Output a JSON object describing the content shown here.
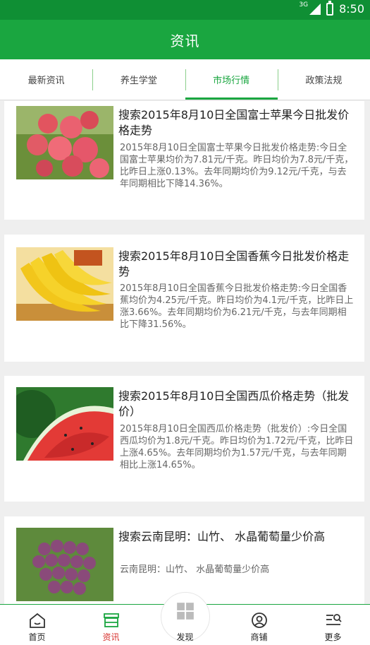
{
  "status_bar": {
    "network": "3G",
    "time": "8:50"
  },
  "header": {
    "title": "资讯"
  },
  "tabs": [
    {
      "label": "最新资讯",
      "active": false
    },
    {
      "label": "养生学堂",
      "active": false
    },
    {
      "label": "市场行情",
      "active": true
    },
    {
      "label": "政策法规",
      "active": false
    }
  ],
  "articles": [
    {
      "title": "搜索2015年8月10日全国富士苹果今日批发价格走势",
      "summary": "2015年8月10日全国富士苹果今日批发价格走势:今日全国富士苹果均价为7.81元/千克。昨日均价为7.8元/千克，比昨日上涨0.13%。去年同期均价为9.12元/千克，与去年同期相比下降14.36%。",
      "image": "apples"
    },
    {
      "title": "搜索2015年8月10日全国香蕉今日批发价格走势",
      "summary": " 2015年8月10日全国香蕉今日批发价格走势:今日全国香蕉均价为4.25元/千克。昨日均价为4.1元/千克，比昨日上涨3.66%。去年同期均价为6.21元/千克，与去年同期相比下降31.56%。",
      "image": "bananas"
    },
    {
      "title": "搜索2015年8月10日全国西瓜价格走势（批发价）",
      "summary": "2015年8月10日全国西瓜价格走势（批发价）:今日全国西瓜均价为1.8元/千克。昨日均价为1.72元/千克，比昨日上涨4.65%。去年同期均价为1.57元/千克，与去年同期相比上涨14.65%。",
      "image": "watermelon"
    },
    {
      "title": "搜索云南昆明：山竹、 水晶葡萄量少价高",
      "summary": "云南昆明：山竹、 水晶葡萄量少价高",
      "image": "grapes"
    }
  ],
  "bottom_nav": [
    {
      "label": "首页",
      "icon": "home-icon",
      "active": false
    },
    {
      "label": "资讯",
      "icon": "news-icon",
      "active": true
    },
    {
      "label": "发现",
      "icon": "discover-grid-icon",
      "active": false
    },
    {
      "label": "商铺",
      "icon": "user-circle-icon",
      "active": false
    },
    {
      "label": "更多",
      "icon": "more-menu-icon",
      "active": false
    }
  ],
  "colors": {
    "primary_green": "#1aa640",
    "status_green": "#0f8f34",
    "active_red": "#d7332f"
  }
}
